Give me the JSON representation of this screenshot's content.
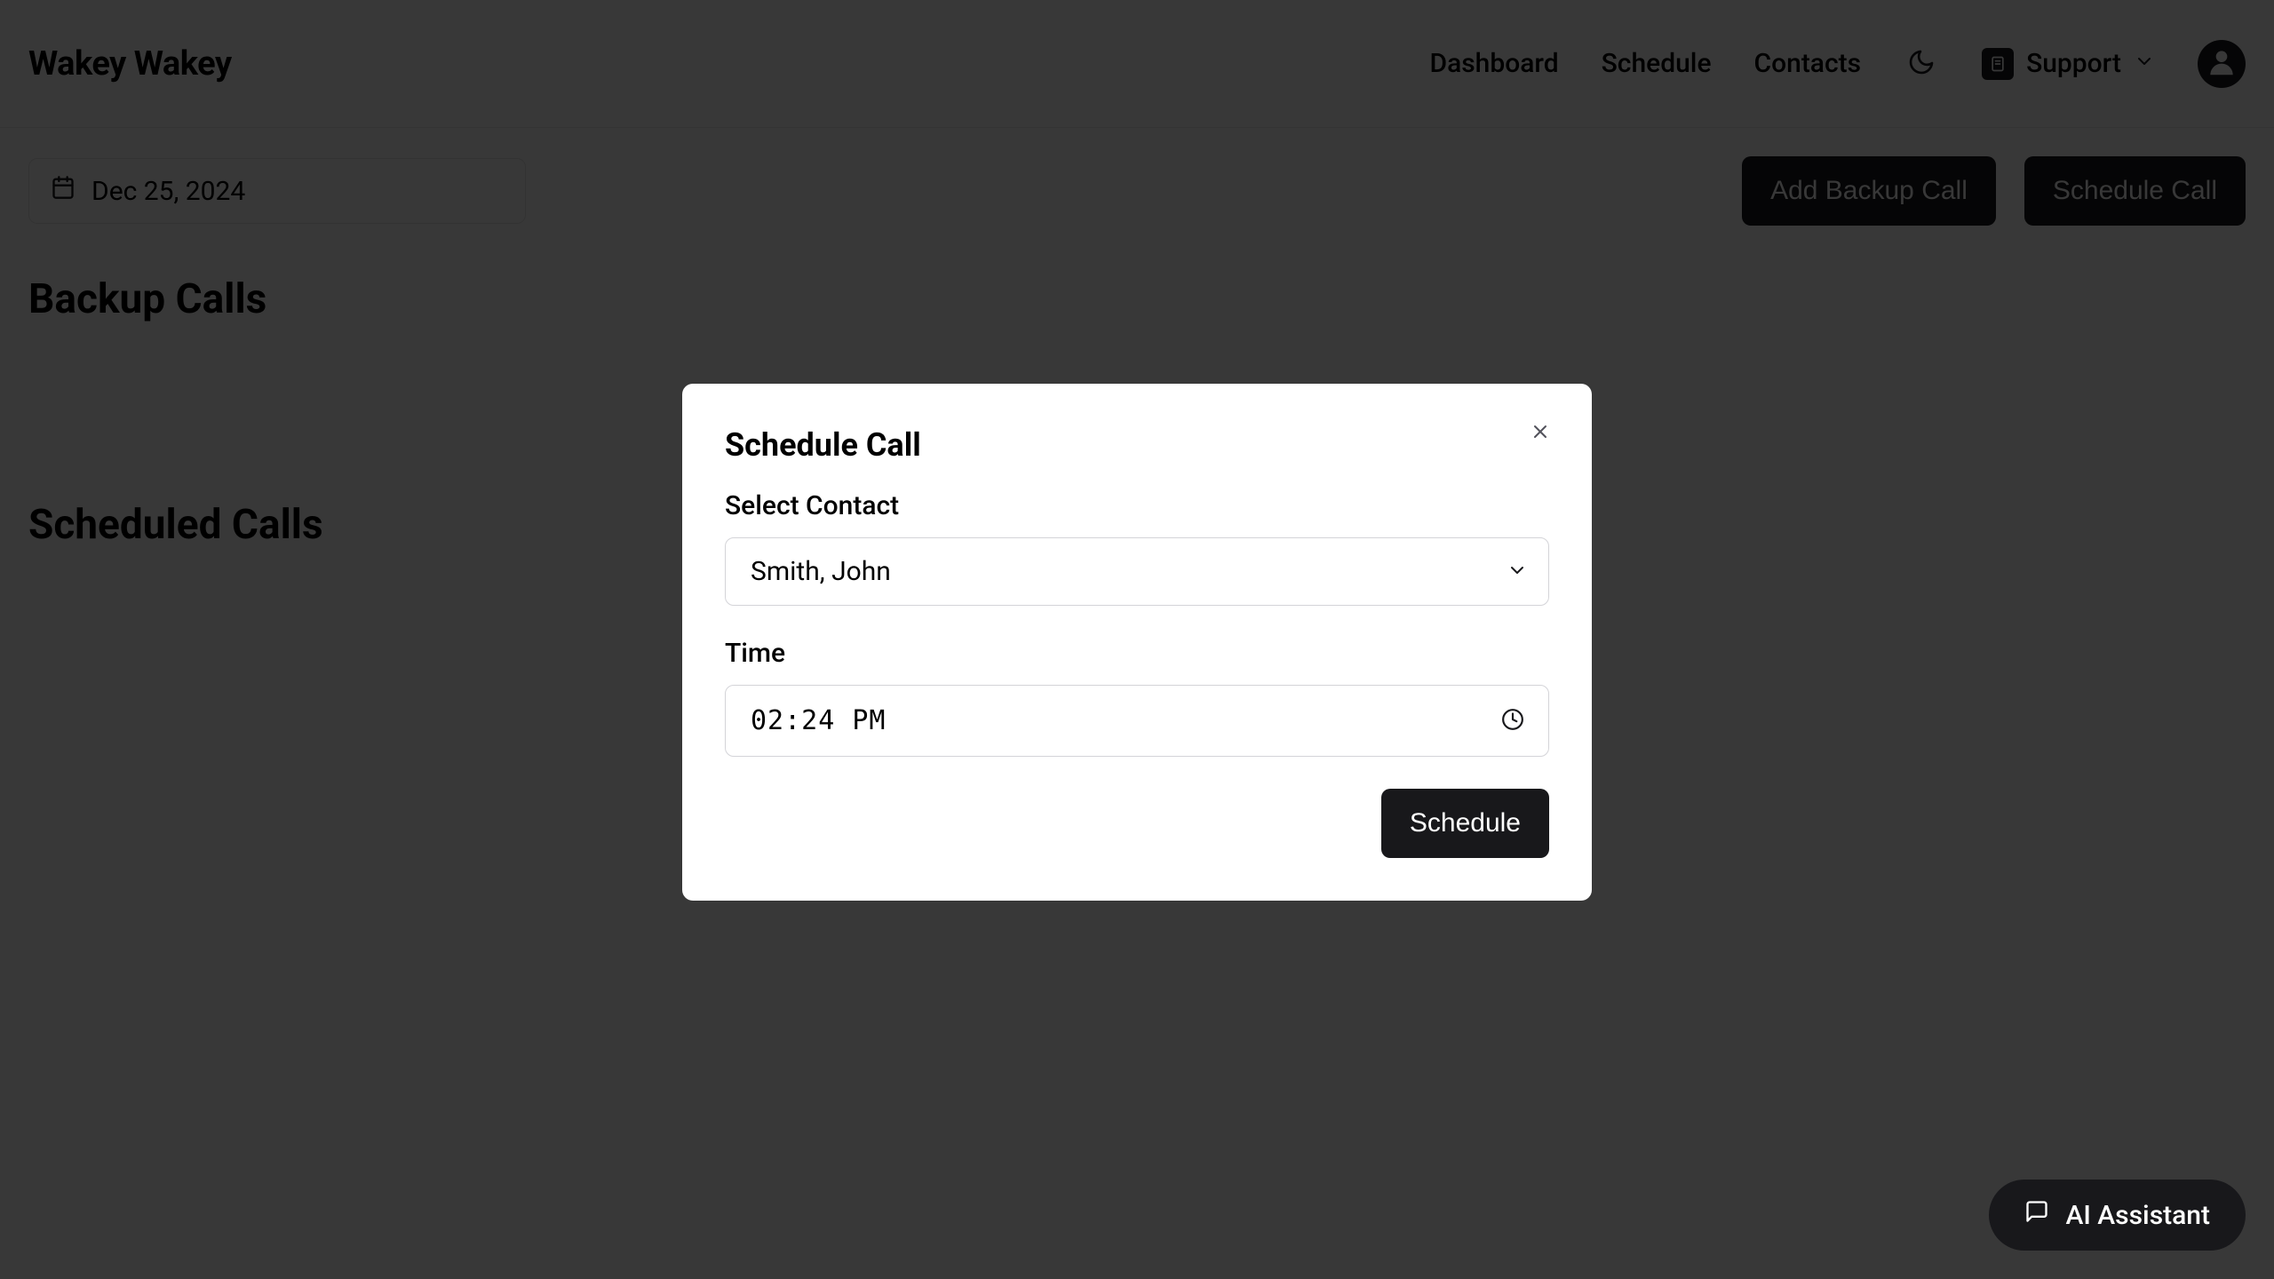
{
  "header": {
    "logo": "Wakey Wakey",
    "nav": {
      "dashboard": "Dashboard",
      "schedule": "Schedule",
      "contacts": "Contacts",
      "support": "Support"
    }
  },
  "toolbar": {
    "date": "Dec 25, 2024",
    "add_backup_label": "Add Backup Call",
    "schedule_call_label": "Schedule Call"
  },
  "sections": {
    "backup_heading": "Backup Calls",
    "scheduled_heading": "Scheduled Calls"
  },
  "modal": {
    "title": "Schedule Call",
    "contact_label": "Select Contact",
    "contact_value": "Smith, John",
    "time_label": "Time",
    "time_value": "02:24 PM",
    "submit_label": "Schedule"
  },
  "fab": {
    "label": "AI Assistant"
  }
}
